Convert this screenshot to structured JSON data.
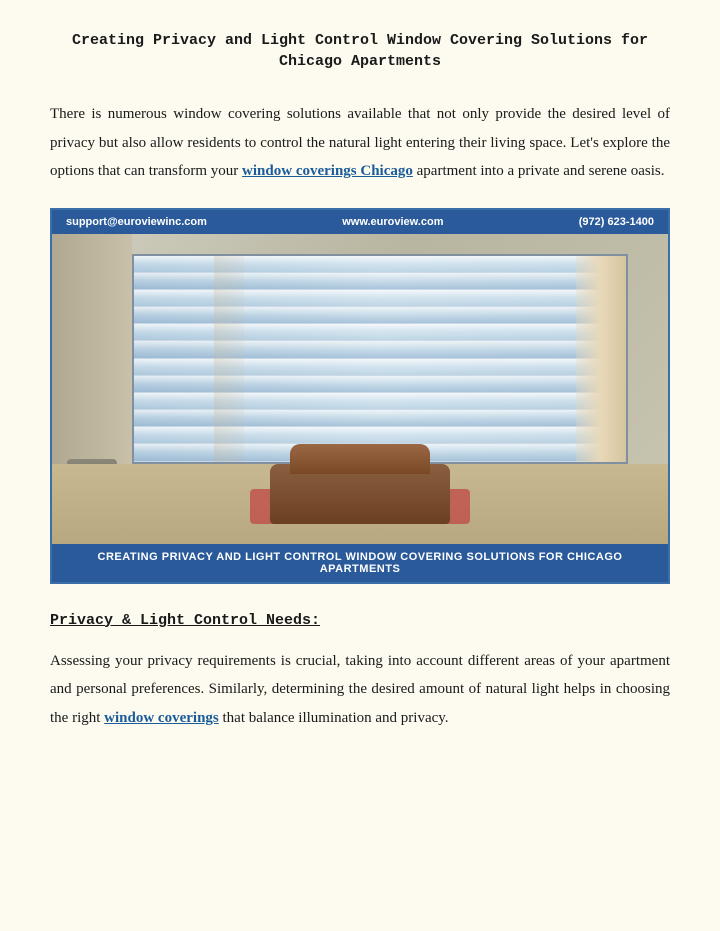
{
  "page": {
    "title": "Creating Privacy and Light Control Window Covering Solutions for Chicago Apartments",
    "intro_paragraph": "There is numerous window covering solutions available that not only provide the desired level of privacy but also allow residents to control the natural light entering their living space. Let's explore the options that can transform your ",
    "link1_text": "window coverings Chicago",
    "intro_paragraph2": " apartment into a private and serene oasis.",
    "image": {
      "top_bar_left": "support@euroviewinc.com",
      "top_bar_center": "www.euroview.com",
      "top_bar_right": "(972) 623-1400",
      "bottom_caption": "Creating Privacy and Light Control Window Covering Solutions for Chicago Apartments"
    },
    "section1": {
      "heading": "Privacy & Light Control Needs:",
      "paragraph_start": "Assessing your privacy requirements is crucial, taking into account different areas of your apartment and personal preferences. Similarly, determining the desired amount of natural light helps in choosing the right ",
      "link2_text": "window coverings",
      "paragraph_end": " that balance illumination and privacy."
    }
  }
}
